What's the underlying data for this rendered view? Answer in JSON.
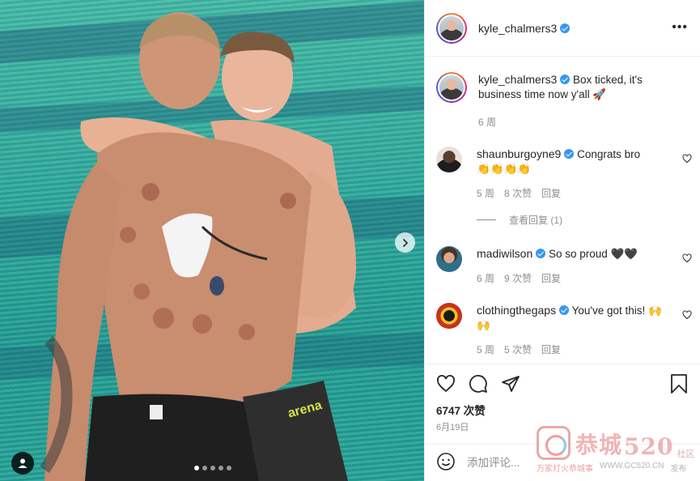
{
  "post": {
    "username": "kyle_chalmers3",
    "more_label": "•••",
    "caption": "Box ticked, it's business time now y'all 🚀",
    "caption_time": "6 周",
    "carousel": {
      "slides": 5,
      "active_index": 0
    }
  },
  "photo": {
    "trunks_brand": "arena"
  },
  "comments": [
    {
      "username": "shaunburgoyne9",
      "text": "Congrats bro",
      "emoji": "👏👏👏👏",
      "time": "5 周",
      "likes": "8 次赞",
      "reply": "回复",
      "avatar_color": "#2b2b2b"
    },
    {
      "username": "madiwilson",
      "text": "So so proud",
      "emoji": "🖤🖤",
      "time": "6 周",
      "likes": "9 次赞",
      "reply": "回复",
      "avatar_color": "#3a6d8a"
    },
    {
      "username": "clothingthegaps",
      "text": "You've got this!",
      "emoji": "🙌🙌",
      "time": "5 周",
      "likes": "5 次赞",
      "reply": "回复",
      "avatar_color": "#1a1a1a"
    }
  ],
  "view_replies": "查看回复 (1)",
  "actions": {
    "likes": "6747 次赞",
    "date": "6月19日"
  },
  "comment_input": {
    "placeholder": "添加评论..."
  },
  "watermark": {
    "title": "恭城",
    "number": "520",
    "side": "社区",
    "slogan": "万家灯火恭城事",
    "url": "WWW.GC520.CN",
    "overlay": "发布"
  },
  "colors": {
    "verified": "#3897f0",
    "pool_teal": "#2aa79a",
    "muted_text": "#8e8e8e"
  }
}
